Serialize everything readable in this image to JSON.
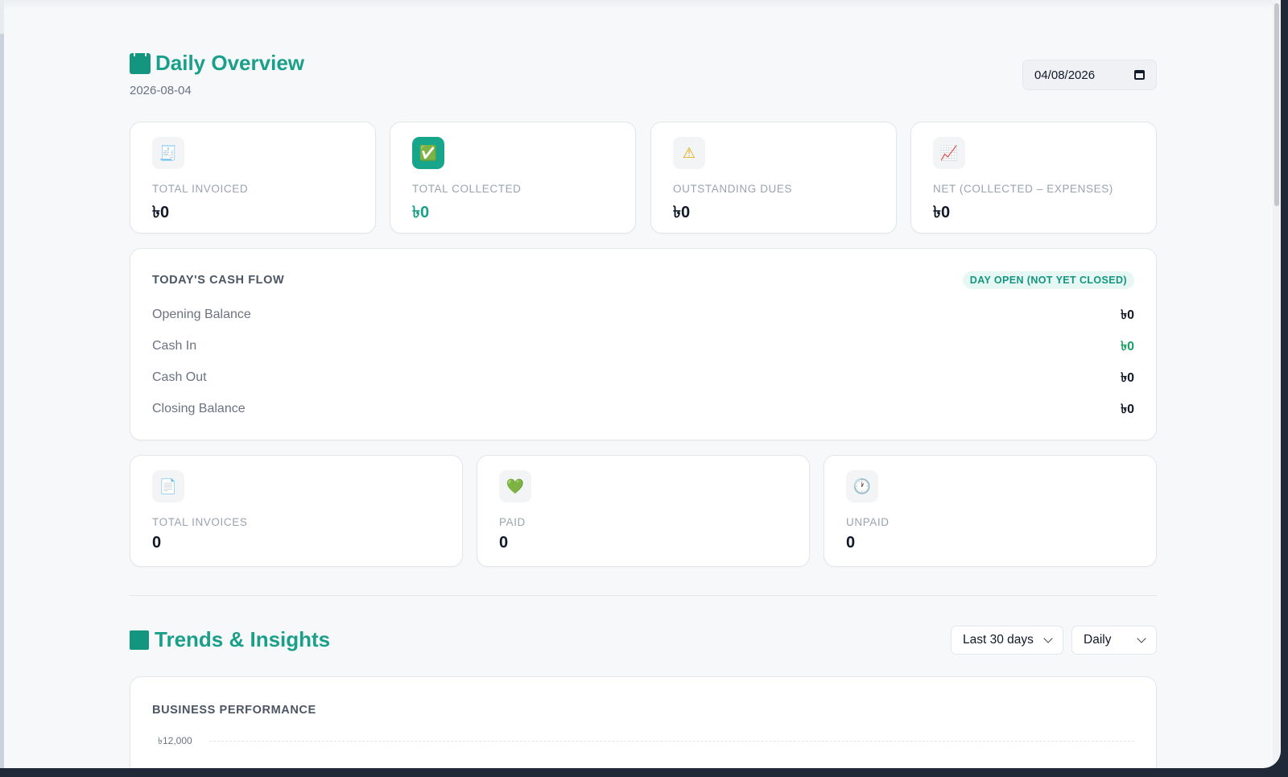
{
  "header": {
    "title": "Daily Overview",
    "date_label": "2026-08-04",
    "date_input_value": "04/08/2026"
  },
  "stats": [
    {
      "icon": "receipt-icon",
      "glyph": "🧾",
      "label": "TOTAL INVOICED",
      "value": "৳0"
    },
    {
      "icon": "check-icon",
      "glyph": "✅",
      "label": "TOTAL COLLECTED",
      "value": "৳0"
    },
    {
      "icon": "warning-icon",
      "glyph": "⚠",
      "label": "OUTSTANDING DUES",
      "value": "৳0"
    },
    {
      "icon": "chart-up-icon",
      "glyph": "📈",
      "label": "NET (COLLECTED – EXPENSES)",
      "value": "৳0"
    }
  ],
  "cash_flow": {
    "title": "TODAY'S CASH FLOW",
    "status_badge": "DAY OPEN (NOT YET CLOSED)",
    "rows": [
      {
        "label": "Opening Balance",
        "value": "৳0"
      },
      {
        "label": "Cash In",
        "value": "৳0"
      },
      {
        "label": "Cash Out",
        "value": "৳0"
      },
      {
        "label": "Closing Balance",
        "value": "৳0"
      }
    ]
  },
  "invoice_stats": [
    {
      "icon": "document-icon",
      "glyph": "📄",
      "label": "TOTAL INVOICES",
      "value": "0"
    },
    {
      "icon": "green-heart-icon",
      "glyph": "💚",
      "label": "PAID",
      "value": "0"
    },
    {
      "icon": "clock-icon",
      "glyph": "🕐",
      "label": "UNPAID",
      "value": "0"
    }
  ],
  "trends": {
    "title": "Trends & Insights",
    "range_select": "Last 30 days",
    "interval_select": "Daily"
  },
  "business_performance": {
    "title": "BUSINESS PERFORMANCE",
    "top_tick": "৳12,000"
  },
  "colors": {
    "accent": "#1aa08a",
    "cash_in": "#1aa065",
    "background": "#f7f8fa"
  }
}
